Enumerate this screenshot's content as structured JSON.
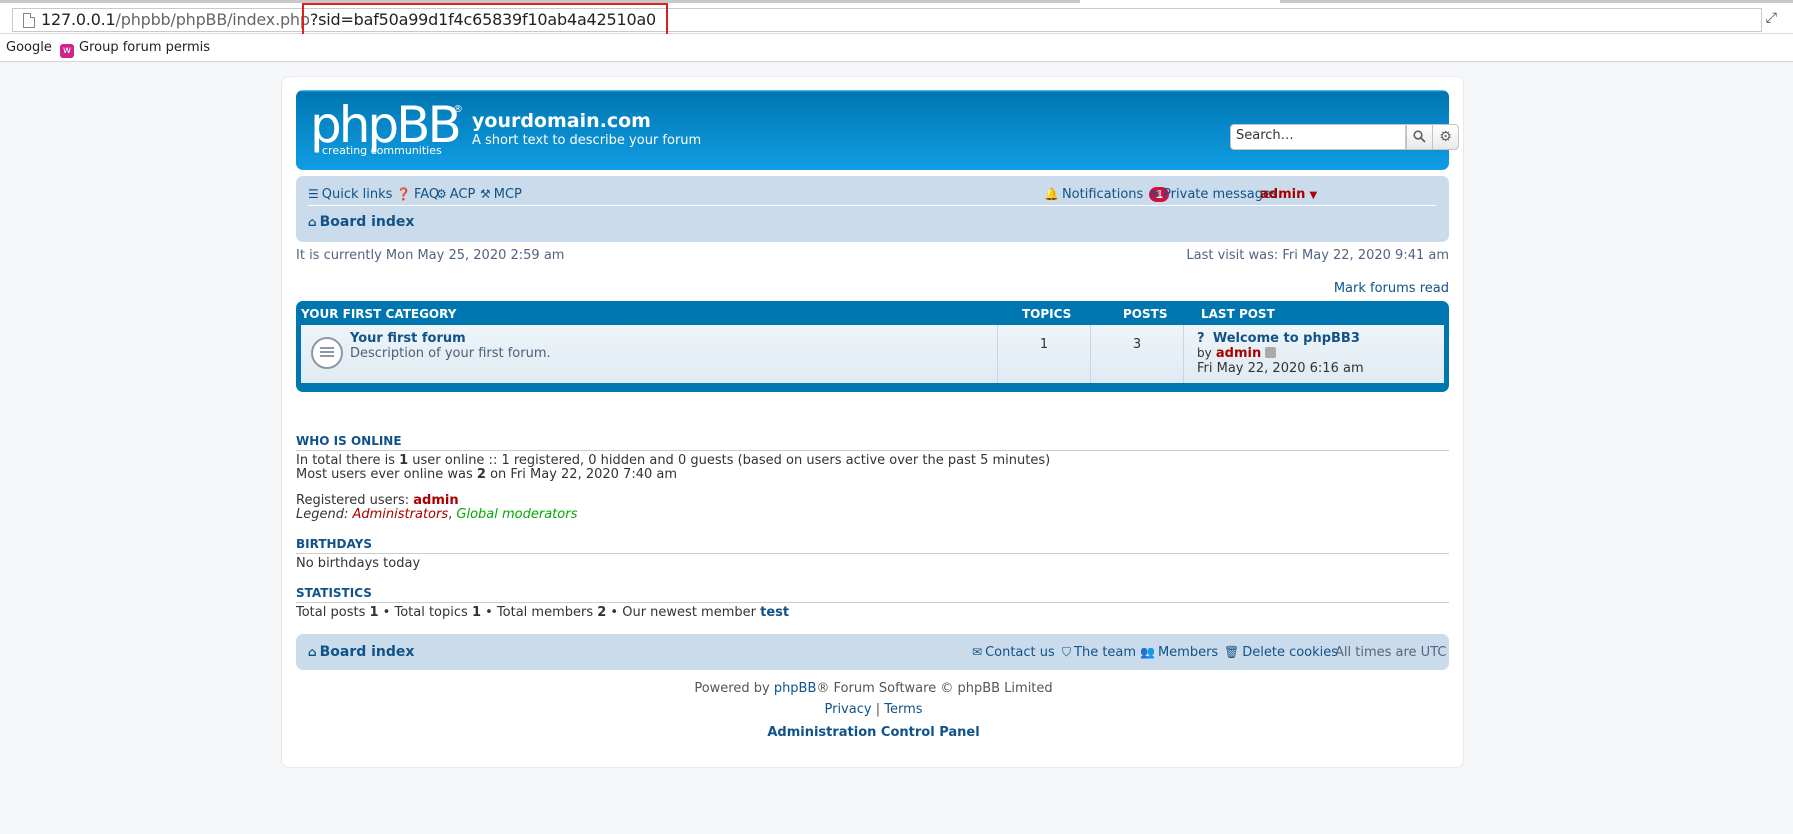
{
  "browser": {
    "url_host": "127.0.0.1",
    "url_path": "/phpbb/phpBB/index.php",
    "url_query": "?sid=baf50a99d1f4c65839f10ab4a42510a0",
    "bookmarks": [
      {
        "label": "Google"
      },
      {
        "label": "Group forum permis"
      }
    ]
  },
  "header": {
    "logo_text": "phpBB",
    "logo_reg": "®",
    "logo_tagline": "creating   communities",
    "site_name": "yourdomain.com",
    "site_description": "A short text to describe your forum",
    "search_placeholder": "Search…"
  },
  "navbar": {
    "quick_links": "Quick links",
    "faq": "FAQ",
    "acp": "ACP",
    "mcp": "MCP",
    "notifications": "Notifications",
    "notifications_count": "1",
    "private_messages": "Private messages",
    "username": "admin",
    "board_index": "Board index"
  },
  "time": {
    "current": "It is currently Mon May 25, 2020 2:59 am",
    "last_visit": "Last visit was: Fri May 22, 2020 9:41 am",
    "mark_read": "Mark forums read"
  },
  "category": {
    "name": "Your first category",
    "col_topics": "Topics",
    "col_posts": "Posts",
    "col_last_post": "Last post",
    "forums": [
      {
        "title": "Your first forum",
        "description": "Description of your first forum.",
        "topics": "1",
        "posts": "3",
        "last_post_title": "Welcome to phpBB3",
        "last_post_by_label": "by",
        "last_post_author": "admin",
        "last_post_time": "Fri May 22, 2020 6:16 am"
      }
    ]
  },
  "who_is_online": {
    "title": "Who is online",
    "line1_a": "In total there is ",
    "line1_count": "1",
    "line1_b": " user online :: 1 registered, 0 hidden and 0 guests (based on users active over the past 5 minutes)",
    "line2_a": "Most users ever online was ",
    "line2_count": "2",
    "line2_b": " on Fri May 22, 2020 7:40 am",
    "registered_label": "Registered users: ",
    "registered_user": "admin",
    "legend_label": "Legend: ",
    "legend_admins": "Administrators",
    "legend_sep": ", ",
    "legend_mods": "Global moderators"
  },
  "birthdays": {
    "title": "Birthdays",
    "text": "No birthdays today"
  },
  "statistics": {
    "title": "Statistics",
    "p1": "Total posts ",
    "posts": "1",
    "p2": " • Total topics ",
    "topics": "1",
    "p3": " • Total members ",
    "members": "2",
    "p4": " • Our newest member ",
    "newest": "test"
  },
  "footer": {
    "board_index": "Board index",
    "contact": "Contact us",
    "team": "The team",
    "members": "Members",
    "delete_cookies": "Delete cookies",
    "timezone": "All times are UTC",
    "powered_a": "Powered by ",
    "powered_link": "phpBB",
    "powered_b": "® Forum Software © phpBB Limited",
    "privacy": "Privacy",
    "sep": " | ",
    "terms": "Terms",
    "acp_link": "Administration Control Panel"
  },
  "colors": {
    "header_blue": "#12a3eb",
    "nav_bg": "#cadceb",
    "link": "#105289",
    "admin_red": "#aa0000",
    "mod_green": "#00aa00",
    "highlight_box": "#e0201e"
  }
}
